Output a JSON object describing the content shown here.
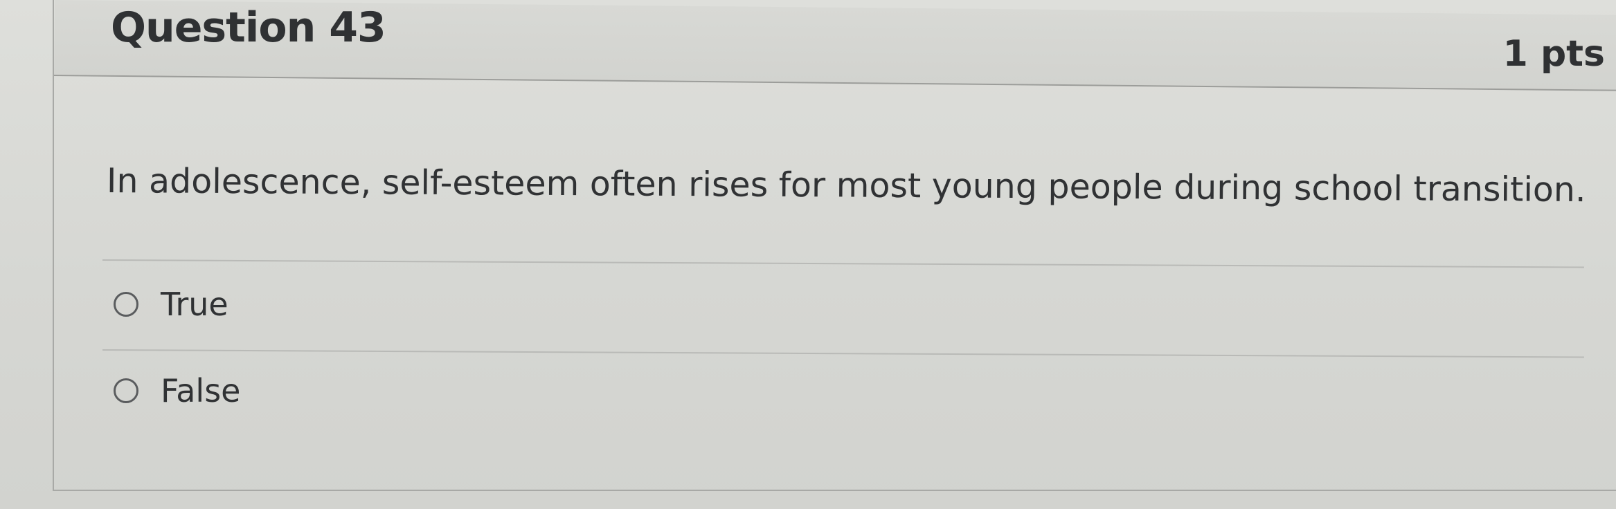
{
  "question": {
    "title": "Question 43",
    "points": "1 pts",
    "text": "In adolescence, self-esteem often rises for most young people during school transition.",
    "answers": [
      {
        "label": "True",
        "selected": false
      },
      {
        "label": "False",
        "selected": false
      }
    ]
  },
  "icons": {
    "answer_radio": "radio-button-unchecked-icon"
  }
}
